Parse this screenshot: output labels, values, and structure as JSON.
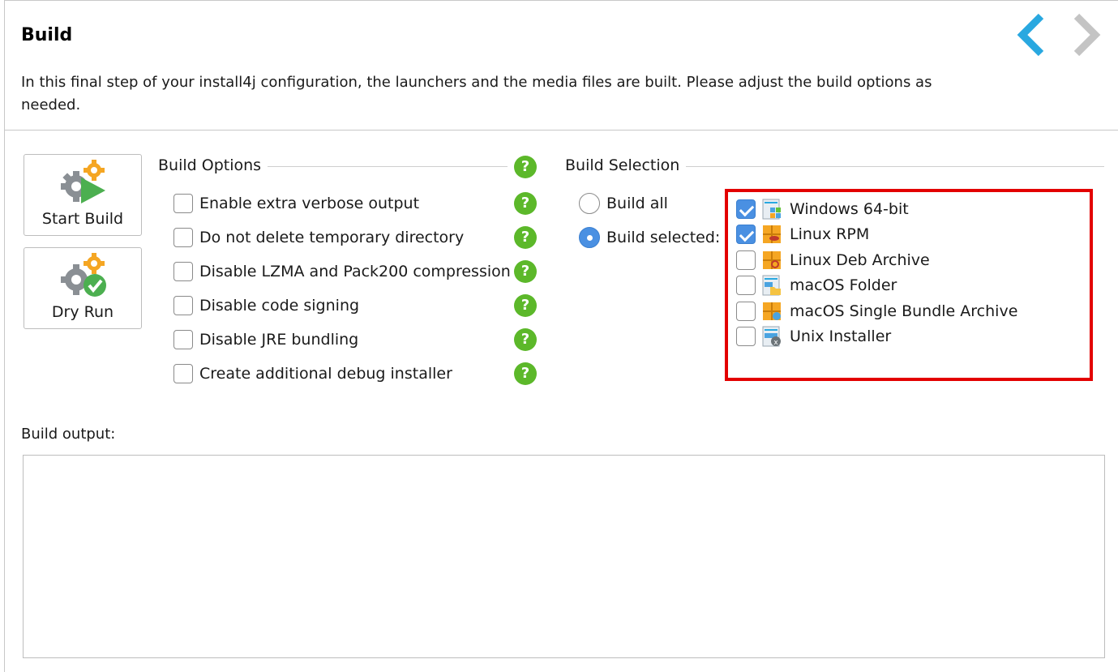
{
  "header": {
    "title": "Build",
    "description": "In this final step of your install4j configuration, the launchers and the media files are built. Please adjust the build options as needed."
  },
  "nav": {
    "back_icon": "chevron-left-icon",
    "forward_icon": "chevron-right-icon",
    "back_color": "#29a8e0",
    "forward_color": "#c4c4c4"
  },
  "actions": {
    "start_build": "Start Build",
    "dry_run": "Dry Run"
  },
  "build_options": {
    "title": "Build Options",
    "items": [
      {
        "label": "Enable extra verbose output",
        "checked": false
      },
      {
        "label": "Do not delete temporary directory",
        "checked": false
      },
      {
        "label": "Disable LZMA and Pack200 compression",
        "checked": false
      },
      {
        "label": "Disable code signing",
        "checked": false
      },
      {
        "label": "Disable JRE bundling",
        "checked": false
      },
      {
        "label": "Create additional debug installer",
        "checked": false
      }
    ],
    "help_glyph": "?"
  },
  "build_selection": {
    "title": "Build Selection",
    "radios": [
      {
        "label": "Build all",
        "selected": false
      },
      {
        "label": "Build selected:",
        "selected": true
      }
    ],
    "media": [
      {
        "label": "Windows 64-bit",
        "checked": true,
        "icon": "windows-media-icon"
      },
      {
        "label": "Linux RPM",
        "checked": true,
        "icon": "linux-rpm-icon"
      },
      {
        "label": "Linux Deb Archive",
        "checked": false,
        "icon": "linux-deb-icon"
      },
      {
        "label": "macOS Folder",
        "checked": false,
        "icon": "macos-folder-icon"
      },
      {
        "label": "macOS Single Bundle Archive",
        "checked": false,
        "icon": "macos-archive-icon"
      },
      {
        "label": "Unix Installer",
        "checked": false,
        "icon": "unix-installer-icon"
      }
    ],
    "highlight_color": "#e30000"
  },
  "output": {
    "label": "Build output:",
    "value": ""
  },
  "colors": {
    "accent": "#4a90e2",
    "help_green": "#5cb82a",
    "gear_orange": "#f5a623",
    "play_green": "#4caf50"
  }
}
